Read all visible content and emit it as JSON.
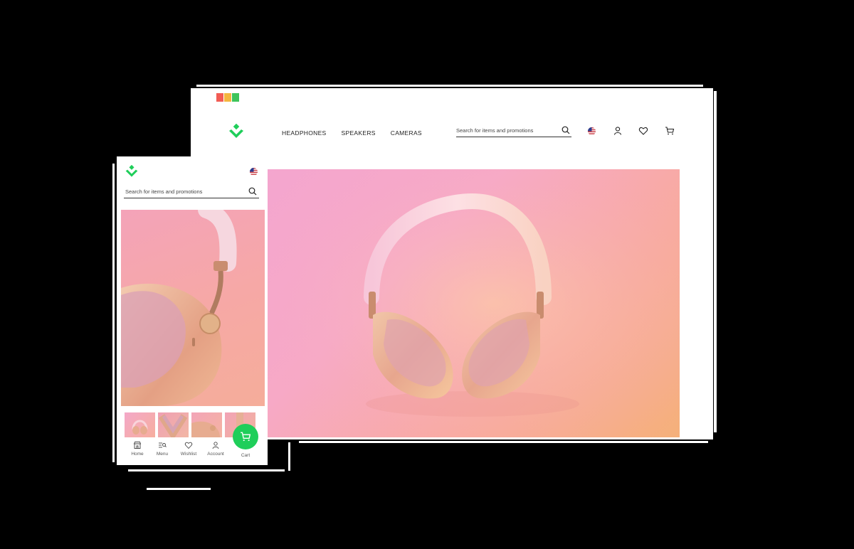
{
  "colors": {
    "brand_green": "#1fce5a",
    "hero_pink": "#f4a6cf",
    "hero_peach": "#f5b07a",
    "traffic_red": "#f25c54",
    "traffic_yellow": "#f4b63f",
    "traffic_green": "#3ec45b"
  },
  "desktop": {
    "nav": [
      "HEADPHONES",
      "SPEAKERS",
      "CAMERAS"
    ],
    "search": {
      "placeholder": "Search for items and promotions"
    },
    "icons": [
      "us-flag-icon",
      "account-icon",
      "wishlist-icon",
      "cart-icon"
    ],
    "hero_image": "headphones-product-photo"
  },
  "mobile": {
    "search": {
      "placeholder": "Search for items and promotions"
    },
    "bottom_nav": [
      {
        "label": "Home",
        "icon": "store-icon"
      },
      {
        "label": "Menu",
        "icon": "menu-search-icon"
      },
      {
        "label": "Wishlist",
        "icon": "heart-icon"
      },
      {
        "label": "Account",
        "icon": "person-icon"
      },
      {
        "label": "Cart",
        "icon": "cart-icon"
      }
    ],
    "thumbnails": [
      "thumb-front",
      "thumb-cushions",
      "thumb-side",
      "thumb-detail"
    ]
  }
}
